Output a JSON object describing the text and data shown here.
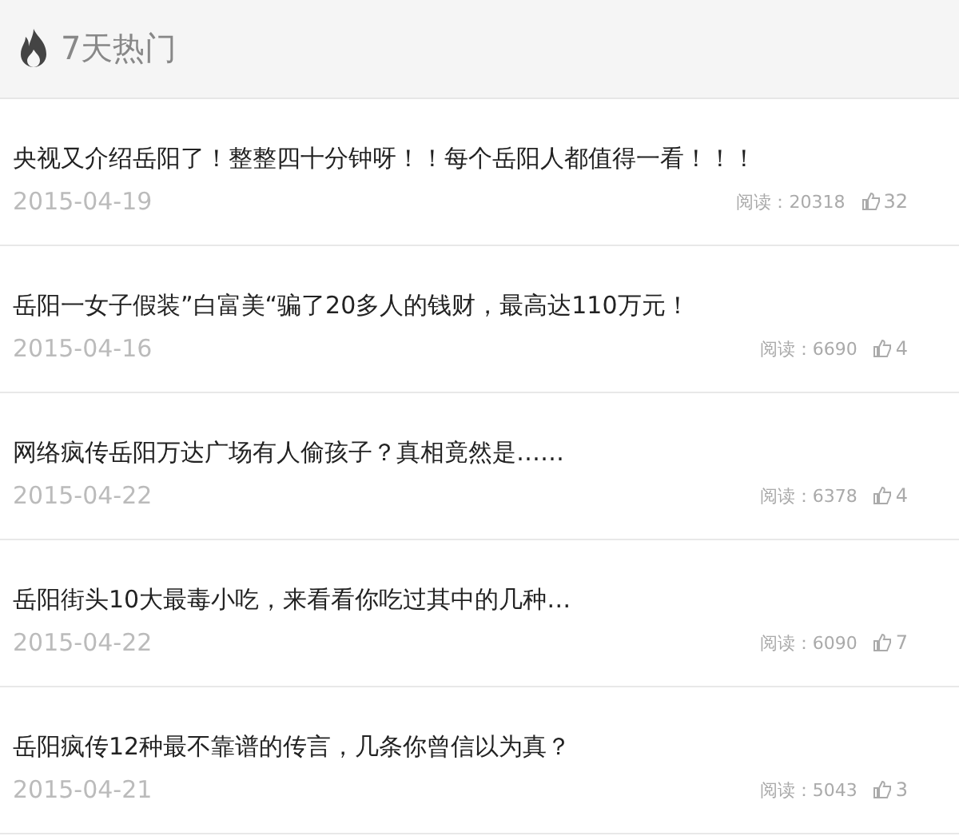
{
  "header": {
    "title": "7天热门"
  },
  "articles": [
    {
      "title": "央视又介绍岳阳了！整整四十分钟呀！！每个岳阳人都值得一看！！！",
      "date": "2015-04-19",
      "reads": "阅读：20318",
      "likes": "32"
    },
    {
      "title": "岳阳一女子假装”白富美“骗了20多人的钱财，最高达110万元！",
      "date": "2015-04-16",
      "reads": "阅读：6690",
      "likes": "4"
    },
    {
      "title": "网络疯传岳阳万达广场有人偷孩子？真相竟然是……",
      "date": "2015-04-22",
      "reads": "阅读：6378",
      "likes": "4"
    },
    {
      "title": "岳阳街头10大最毒小吃，来看看你吃过其中的几种…",
      "date": "2015-04-22",
      "reads": "阅读：6090",
      "likes": "7"
    },
    {
      "title": "岳阳疯传12种最不靠谱的传言，几条你曾信以为真？",
      "date": "2015-04-21",
      "reads": "阅读：5043",
      "likes": "3"
    }
  ]
}
